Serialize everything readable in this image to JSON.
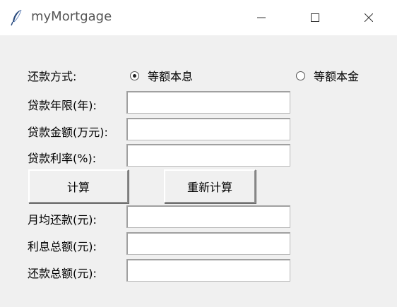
{
  "window": {
    "title": "myMortgage",
    "icons": {
      "app": "feather-icon",
      "minimize": "minimize-icon",
      "maximize": "maximize-icon",
      "close": "close-icon"
    }
  },
  "form": {
    "repayment_method_label": "还款方式:",
    "options": [
      {
        "label": "等额本息",
        "selected": true
      },
      {
        "label": "等额本金",
        "selected": false
      }
    ],
    "years_label": "贷款年限(年):",
    "years_value": "",
    "amount_label": "贷款金额(万元):",
    "amount_value": "",
    "rate_label": "贷款利率(%):",
    "rate_value": ""
  },
  "buttons": {
    "calculate": "计算",
    "recalculate": "重新计算"
  },
  "results": {
    "monthly_label": "月均还款(元):",
    "monthly_value": "",
    "interest_label": "利息总额(元):",
    "interest_value": "",
    "total_label": "还款总额(元):",
    "total_value": ""
  }
}
